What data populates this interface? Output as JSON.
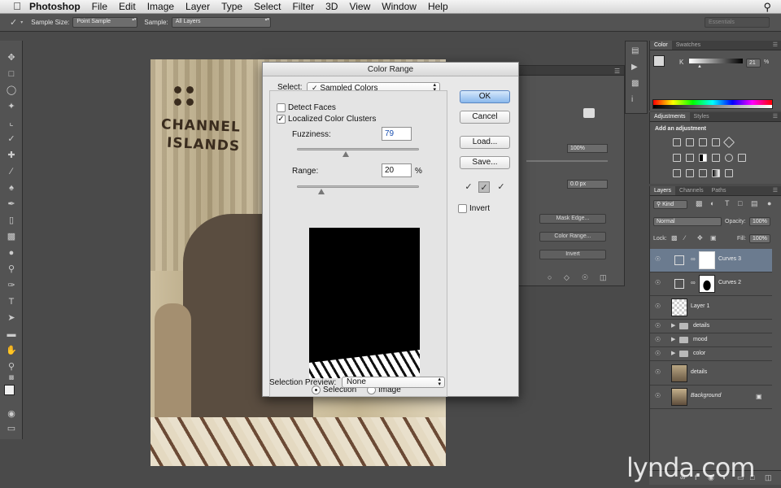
{
  "menubar": {
    "app": "Photoshop",
    "items": [
      "File",
      "Edit",
      "Image",
      "Layer",
      "Type",
      "Select",
      "Filter",
      "3D",
      "View",
      "Window",
      "Help"
    ]
  },
  "options": {
    "sample_size_label": "Sample Size:",
    "sample_size_value": "Point Sample",
    "sample_label": "Sample:",
    "sample_value": "All Layers",
    "workspace": "Essentials"
  },
  "photo": {
    "line1": "CHANNEL",
    "line2": "ISLANDS"
  },
  "behind_panel": {
    "value_100": "100%",
    "value_px": "0.0 px",
    "btn_mask_edge": "Mask Edge...",
    "btn_color_range": "Color Range...",
    "btn_invert": "Invert"
  },
  "dialog": {
    "title": "Color Range",
    "select_label": "Select:",
    "select_value": "Sampled Colors",
    "detect_faces": "Detect Faces",
    "detect_faces_checked": false,
    "localized": "Localized Color Clusters",
    "localized_checked": true,
    "fuzziness_label": "Fuzziness:",
    "fuzziness_value": "79",
    "fuzziness_level": 0.4,
    "range_label": "Range:",
    "range_value": "20",
    "range_unit": "%",
    "range_level": 0.2,
    "view_selection": "Selection",
    "view_image": "Image",
    "view_selected": "selection",
    "preview_label": "Selection Preview:",
    "preview_value": "None",
    "ok": "OK",
    "cancel": "Cancel",
    "load": "Load...",
    "save": "Save...",
    "invert": "Invert",
    "invert_checked": false
  },
  "color_panel": {
    "tabs": [
      "Color",
      "Swatches"
    ],
    "channel": "K",
    "value": "21",
    "unit": "%"
  },
  "adjust_panel": {
    "tabs": [
      "Adjustments",
      "Styles"
    ],
    "heading": "Add an adjustment"
  },
  "layers_panel": {
    "tabs": [
      "Layers",
      "Channels",
      "Paths"
    ],
    "kind": "Kind",
    "blend": "Normal",
    "opacity_label": "Opacity:",
    "opacity": "100%",
    "lock_label": "Lock:",
    "fill_label": "Fill:",
    "fill": "100%",
    "layers": [
      {
        "name": "Curves 3",
        "selected": true
      },
      {
        "name": "Curves 2"
      },
      {
        "name": "Layer 1"
      },
      {
        "name": "details"
      },
      {
        "name": "mood"
      },
      {
        "name": "color"
      },
      {
        "name": "details"
      },
      {
        "name": "Background"
      }
    ]
  },
  "watermark": "lynda.com"
}
